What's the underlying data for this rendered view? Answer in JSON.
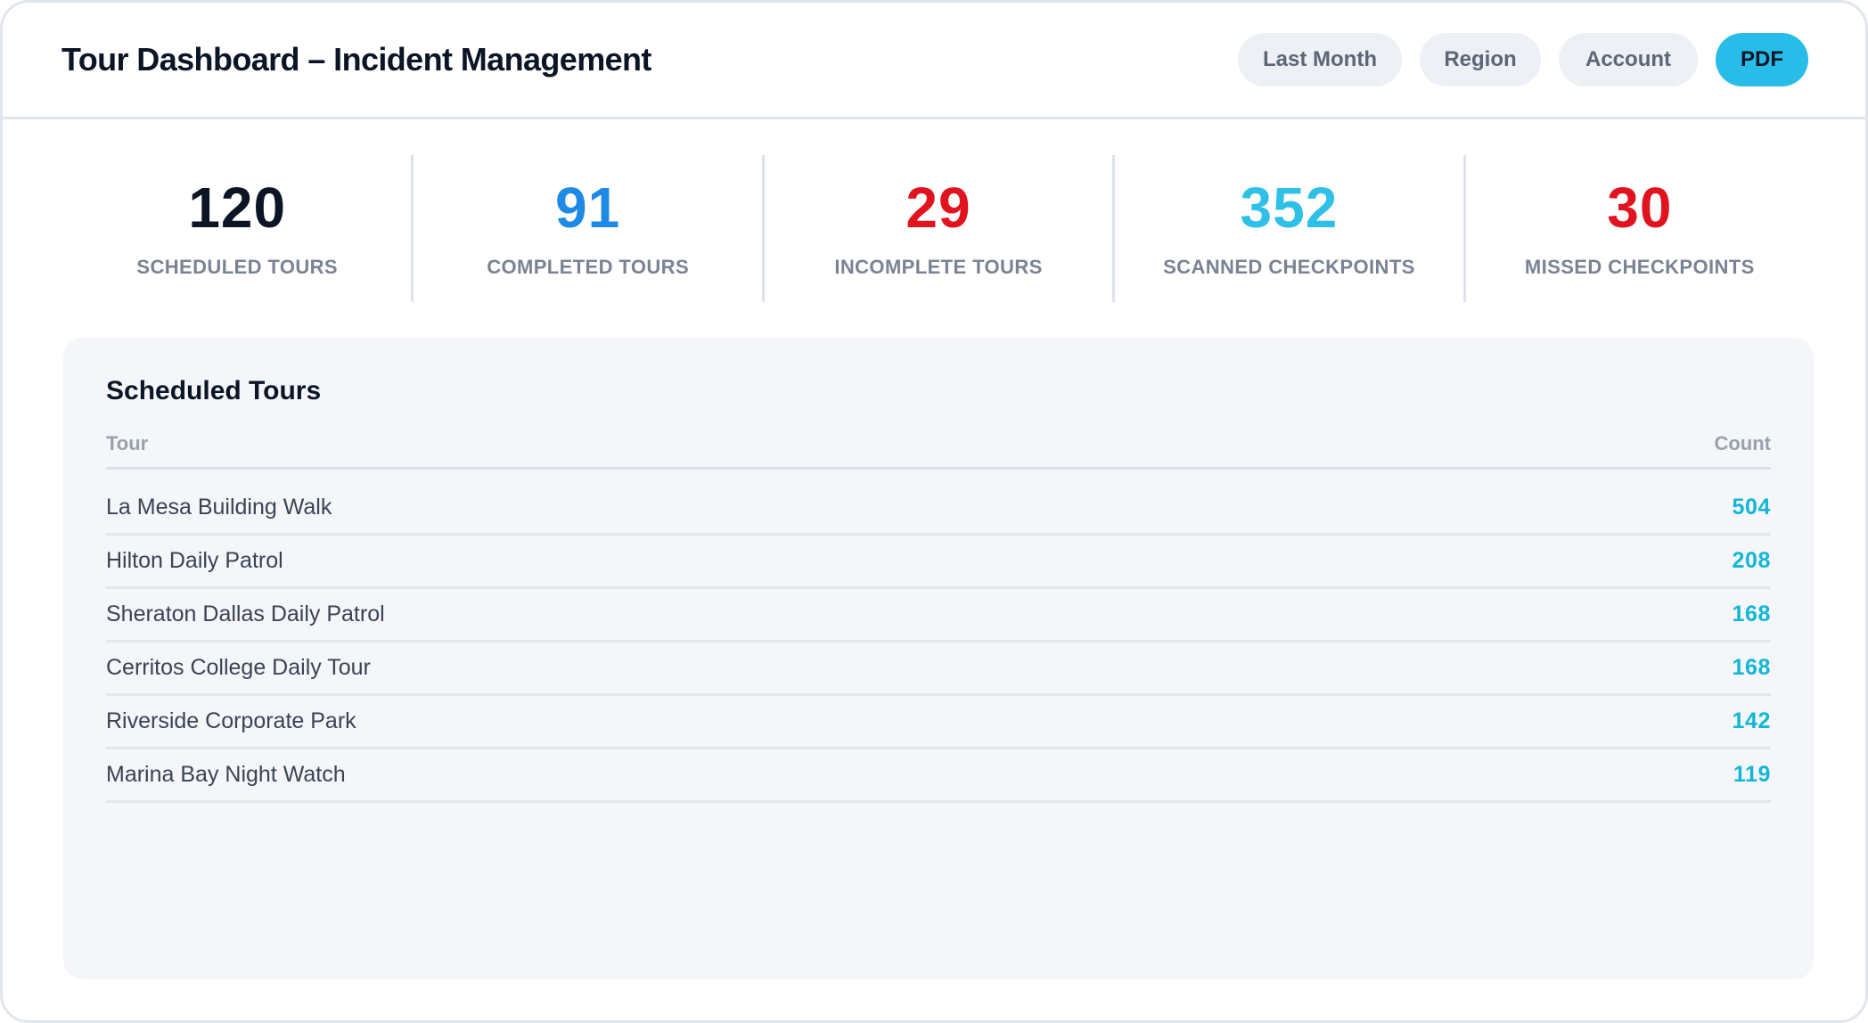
{
  "header": {
    "title": "Tour Dashboard – Incident Management",
    "filters": {
      "last_month": "Last Month",
      "region": "Region",
      "account": "Account",
      "pdf": "PDF"
    }
  },
  "stats": [
    {
      "value": "120",
      "label": "SCHEDULED TOURS",
      "color": "#0b1526"
    },
    {
      "value": "91",
      "label": "COMPLETED TOURS",
      "color": "#1f8ae6"
    },
    {
      "value": "29",
      "label": "INCOMPLETE TOURS",
      "color": "#e0131f"
    },
    {
      "value": "352",
      "label": "SCANNED CHECKPOINTS",
      "color": "#2fc0e8"
    },
    {
      "value": "30",
      "label": "MISSED CHECKPOINTS",
      "color": "#e0131f"
    }
  ],
  "panel": {
    "title": "Scheduled Tours",
    "columns": {
      "tour": "Tour",
      "count": "Count"
    },
    "rows": [
      {
        "name": "La Mesa Building Walk",
        "count": "504"
      },
      {
        "name": "Hilton Daily Patrol",
        "count": "208"
      },
      {
        "name": "Sheraton Dallas Daily Patrol",
        "count": "168"
      },
      {
        "name": "Cerritos College Daily Tour",
        "count": "168"
      },
      {
        "name": "Riverside Corporate Park",
        "count": "142"
      },
      {
        "name": "Marina Bay Night Watch",
        "count": "119"
      }
    ]
  },
  "colors": {
    "accent": "#27bde8",
    "count_text": "#12b6d6"
  }
}
